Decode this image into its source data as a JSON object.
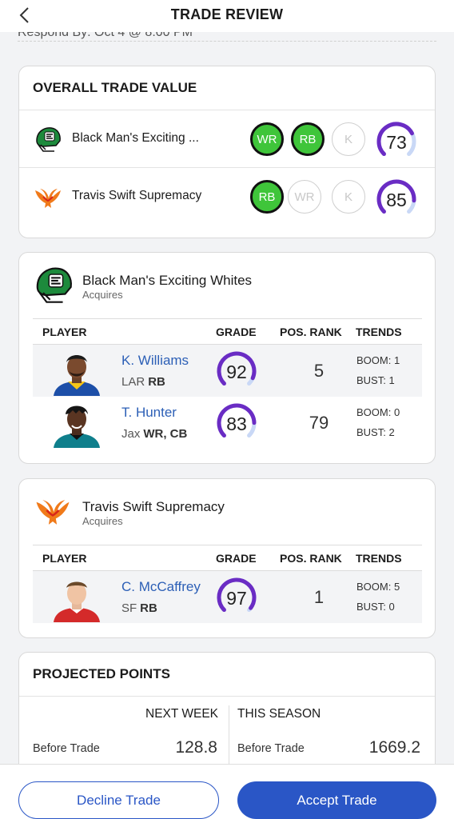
{
  "header": {
    "title": "TRADE REVIEW",
    "respond_by": "Respond By: Oct 4 @ 8:00 PM"
  },
  "overall": {
    "title": "OVERALL TRADE VALUE",
    "teams": [
      {
        "name": "Black Man's Exciting ...",
        "positions": [
          {
            "label": "WR",
            "active": true
          },
          {
            "label": "RB",
            "active": true
          },
          {
            "label": "K",
            "active": false
          }
        ],
        "value": "73",
        "value_pct": 0.73
      },
      {
        "name": "Travis Swift Supremacy",
        "positions": [
          {
            "label": "RB",
            "active": true
          },
          {
            "label": "WR",
            "active": false
          },
          {
            "label": "K",
            "active": false
          }
        ],
        "value": "85",
        "value_pct": 0.85
      }
    ]
  },
  "team_cards": [
    {
      "name": "Black Man's Exciting Whites",
      "sub": "Acquires",
      "headers": {
        "player": "PLAYER",
        "grade": "GRADE",
        "rank": "POS. RANK",
        "trends": "TRENDS"
      },
      "players": [
        {
          "name": "K. Williams",
          "team": "LAR",
          "pos": "RB",
          "grade": "92",
          "grade_pct": 0.92,
          "rank": "5",
          "boom": "BOOM: 1",
          "bust": "BUST: 1"
        },
        {
          "name": "T. Hunter",
          "team": "Jax",
          "pos": "WR, CB",
          "grade": "83",
          "grade_pct": 0.83,
          "rank": "79",
          "boom": "BOOM: 0",
          "bust": "BUST: 2"
        }
      ]
    },
    {
      "name": "Travis Swift Supremacy",
      "sub": "Acquires",
      "headers": {
        "player": "PLAYER",
        "grade": "GRADE",
        "rank": "POS. RANK",
        "trends": "TRENDS"
      },
      "players": [
        {
          "name": "C. McCaffrey",
          "team": "SF",
          "pos": "RB",
          "grade": "97",
          "grade_pct": 0.97,
          "rank": "1",
          "boom": "BOOM: 5",
          "bust": "BUST: 0"
        }
      ]
    }
  ],
  "projected": {
    "title": "PROJECTED POINTS",
    "next_week": {
      "label": "NEXT WEEK",
      "before_label": "Before Trade",
      "before_value": "128.8"
    },
    "this_season": {
      "label": "THIS SEASON",
      "before_label": "Before Trade",
      "before_value": "1669.2"
    }
  },
  "footer": {
    "decline": "Decline Trade",
    "accept": "Accept Trade"
  },
  "colors": {
    "accent": "#2a56c6",
    "gauge": "#6a2cc4",
    "gauge_track": "#c9d8f6",
    "active_pill": "#3fc53a"
  }
}
